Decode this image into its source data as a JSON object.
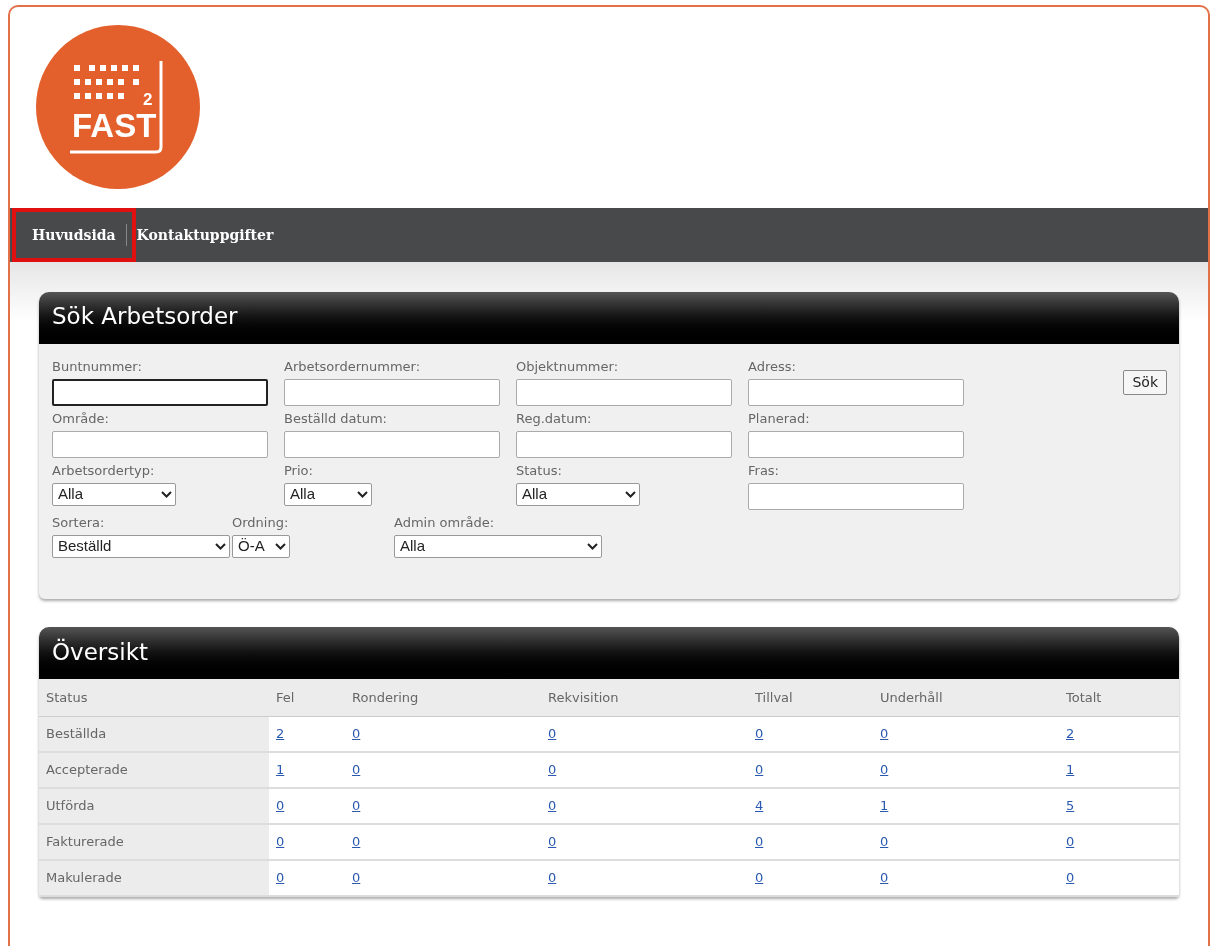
{
  "logo": {
    "superscript": "2",
    "wordmark": "FAST"
  },
  "nav": [
    {
      "label": "Huvudsida",
      "highlighted": true
    },
    {
      "label": "Kontaktuppgifter",
      "highlighted": false
    }
  ],
  "search_panel": {
    "title": "Sök Arbetsorder",
    "rows": [
      [
        {
          "kind": "text",
          "label": "Buntnummer:",
          "focused": true
        },
        {
          "kind": "text",
          "label": "Arbetsordernummer:",
          "focused": false
        },
        {
          "kind": "text",
          "label": "Objektnummer:",
          "focused": false
        },
        {
          "kind": "text",
          "label": "Adress:",
          "focused": false
        }
      ],
      [
        {
          "kind": "text",
          "label": "Område:",
          "focused": false
        },
        {
          "kind": "text",
          "label": "Beställd datum:",
          "focused": false
        },
        {
          "kind": "text",
          "label": "Reg.datum:",
          "focused": false
        },
        {
          "kind": "text",
          "label": "Planerad:",
          "focused": false
        }
      ],
      [
        {
          "kind": "select",
          "label": "Arbetsordertyp:",
          "value": "Alla"
        },
        {
          "kind": "select",
          "label": "Prio:",
          "value": "Alla"
        },
        {
          "kind": "select",
          "label": "Status:",
          "value": "Alla"
        },
        {
          "kind": "text",
          "label": "Fras:",
          "focused": false
        }
      ],
      [
        {
          "kind": "select",
          "label": "Sortera:",
          "value": "Beställd"
        },
        {
          "kind": "select",
          "label": "Ordning:",
          "value": "Ö-A"
        },
        {
          "kind": "select",
          "label": "Admin område:",
          "value": "Alla"
        }
      ]
    ],
    "button": "Sök"
  },
  "overview": {
    "title": "Översikt",
    "columns": [
      "Status",
      "Fel",
      "Rondering",
      "Rekvisition",
      "Tillval",
      "Underhåll",
      "Totalt"
    ],
    "rows": [
      {
        "cells": [
          "Beställda",
          "2",
          "0",
          "0",
          "0",
          "0",
          "2"
        ]
      },
      {
        "cells": [
          "Accepterade",
          "1",
          "0",
          "0",
          "0",
          "0",
          "1"
        ]
      },
      {
        "cells": [
          "Utförda",
          "0",
          "0",
          "0",
          "4",
          "1",
          "5"
        ]
      },
      {
        "cells": [
          "Fakturerade",
          "0",
          "0",
          "0",
          "0",
          "0",
          "0"
        ]
      },
      {
        "cells": [
          "Makulerade",
          "0",
          "0",
          "0",
          "0",
          "0",
          "0"
        ]
      }
    ]
  }
}
